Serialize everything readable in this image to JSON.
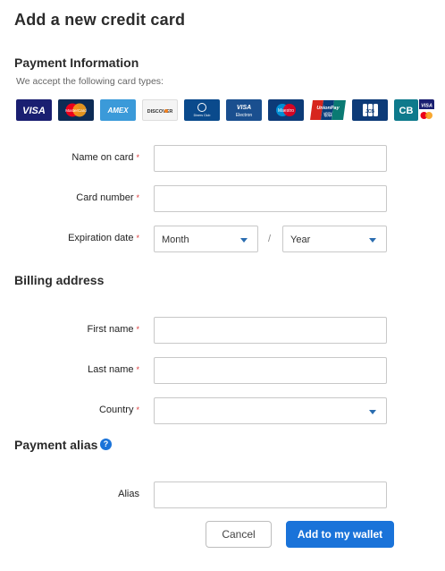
{
  "page_title": "Add a new credit card",
  "payment_info": {
    "title": "Payment Information",
    "subtext": "We accept the following card types:",
    "cards": [
      {
        "name": "visa",
        "text": "VISA"
      },
      {
        "name": "mastercard",
        "text": "MasterCard"
      },
      {
        "name": "amex",
        "text": "AMEX"
      },
      {
        "name": "discover",
        "text": "DISCOVER"
      },
      {
        "name": "diners",
        "text": "Diners Club"
      },
      {
        "name": "visa-electron",
        "text": "VISA Electron"
      },
      {
        "name": "maestro",
        "text": "Maestro"
      },
      {
        "name": "unionpay",
        "text": "UnionPay 银联"
      },
      {
        "name": "jcb",
        "text": "JCB"
      },
      {
        "name": "cb",
        "text": "CB VISA"
      }
    ],
    "fields": {
      "name_label": "Name on card",
      "number_label": "Card number",
      "expiration_label": "Expiration date",
      "month_value": "Month",
      "separator": "/",
      "year_value": "Year"
    }
  },
  "billing": {
    "title": "Billing address",
    "first_name_label": "First name",
    "last_name_label": "Last name",
    "country_label": "Country"
  },
  "alias": {
    "title": "Payment alias",
    "help_icon": "?",
    "alias_label": "Alias"
  },
  "required_mark": "*",
  "buttons": {
    "cancel": "Cancel",
    "add": "Add to my wallet"
  },
  "colors": {
    "accent": "#1a73d9",
    "required": "#d93a3a"
  }
}
